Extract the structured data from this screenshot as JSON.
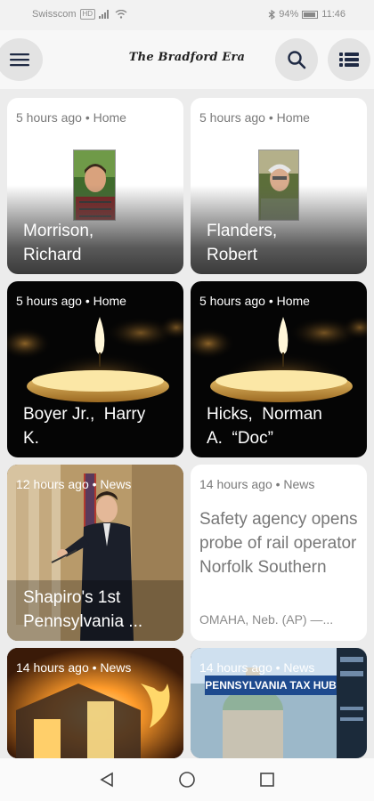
{
  "status_bar": {
    "carrier": "Swisscom",
    "carrier_badge": "HD",
    "battery": "94%",
    "time": "11:46"
  },
  "header": {
    "logo_text": "The Bradford Era",
    "icons": [
      "menu-icon",
      "search-icon",
      "list-icon"
    ]
  },
  "cards": [
    {
      "meta": "5 hours ago • Home",
      "title_lines": [
        "Morrison,",
        "Richard"
      ]
    },
    {
      "meta": "5 hours ago • Home",
      "title_lines": [
        "Flanders,",
        "Robert"
      ]
    },
    {
      "meta": "5 hours ago • Home",
      "title_lines": [
        "Boyer Jr.,  Harry",
        "K."
      ]
    },
    {
      "meta": "5 hours ago • Home",
      "title_lines": [
        "Hicks,  Norman",
        "A.  “Doc”"
      ]
    },
    {
      "meta": "12 hours ago • News",
      "title_lines": [
        "Shapiro's 1st",
        "Pennsylvania ..."
      ]
    },
    {
      "meta": "14 hours ago • News",
      "title": "Safety agency opens probe of rail operator Norfolk Southern",
      "subtitle": "OMAHA, Neb. (AP) —..."
    },
    {
      "meta": "14 hours ago • News"
    },
    {
      "meta": "14 hours ago • News",
      "banner": "PENNSYLVANIA TAX HUB"
    }
  ],
  "colors": {
    "background": "#ececec",
    "card_light": "#ffffff",
    "card_dark": "#050505",
    "meta_grey": "#7a7a7a"
  },
  "nav_bar": {
    "icons": [
      "back-icon",
      "home-icon",
      "recents-icon"
    ]
  }
}
